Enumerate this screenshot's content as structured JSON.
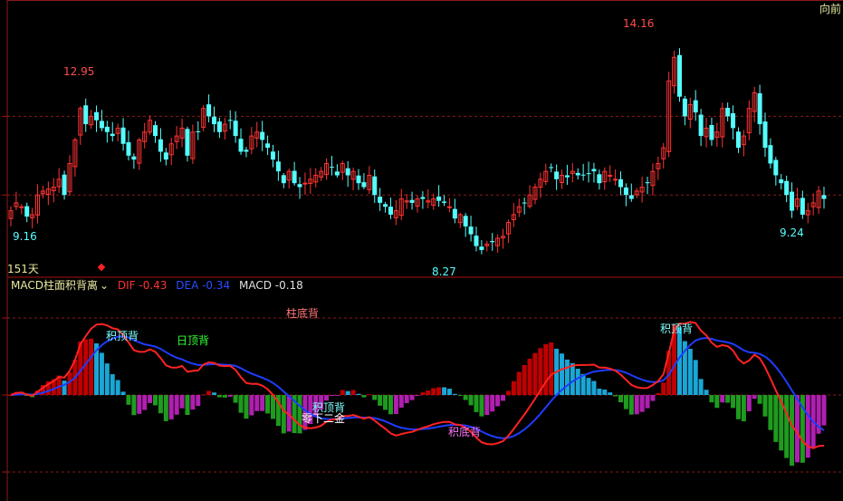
{
  "header": {
    "corner_label": "向前"
  },
  "price_panel": {
    "period_label": "151天",
    "high_label": "12.95",
    "peak_label": "14.16",
    "low_label_left": "9.16",
    "low_label_mid": "8.27",
    "low_label_right": "9.24"
  },
  "macd_panel": {
    "indicator_name": "MACD柱面积背离",
    "dif_text": "DIF -0.43",
    "dea_text": "DEA -0.34",
    "macd_text": "MACD -0.18",
    "annotations": [
      "柱底背",
      "积顶背",
      "日顶背",
      "积顶背",
      "零下二金",
      "积底背",
      "积顶背"
    ]
  },
  "colors": {
    "background": "#000000",
    "up": "#ff3333",
    "down": "#54ffff",
    "dif": "#ff2222",
    "dea": "#1f3cff",
    "hist_pos_red": "#c00000",
    "hist_pos_cyan": "#1aa6d6",
    "hist_neg_green": "#1f9b1f",
    "hist_neg_purple": "#b01fb0",
    "grid": "#8a1a1a",
    "axis": "#8a1a1a"
  },
  "chart_data": [
    {
      "type": "candlestick",
      "title": "",
      "ylim": [
        8.0,
        14.5
      ],
      "marked_values": {
        "high_left": 12.95,
        "peak": 14.16,
        "low_left": 9.16,
        "low_mid": 8.27,
        "low_right": 9.24
      },
      "close": [
        9.6,
        9.8,
        9.7,
        9.45,
        9.5,
        10.0,
        10.1,
        10.15,
        10.2,
        10.4,
        10.0,
        10.8,
        11.4,
        12.2,
        11.8,
        12.0,
        11.9,
        11.7,
        11.6,
        11.5,
        11.7,
        11.3,
        11.0,
        10.9,
        11.4,
        11.6,
        11.9,
        11.5,
        11.1,
        10.9,
        11.3,
        11.5,
        11.7,
        11.0,
        11.6,
        11.6,
        12.2,
        12.0,
        11.8,
        11.6,
        11.8,
        11.9,
        11.5,
        11.1,
        11.1,
        11.5,
        11.6,
        11.4,
        11.2,
        10.9,
        10.6,
        10.3,
        10.6,
        10.3,
        10.2,
        10.3,
        10.4,
        10.5,
        10.6,
        10.8,
        10.7,
        10.5,
        10.8,
        10.5,
        10.6,
        10.3,
        10.2,
        10.5,
        10.0,
        9.8,
        9.7,
        9.5,
        9.6,
        9.9,
        9.85,
        9.8,
        9.9,
        9.9,
        9.85,
        9.9,
        9.85,
        9.8,
        9.7,
        9.4,
        9.5,
        9.2,
        9.0,
        8.7,
        8.6,
        8.75,
        8.8,
        8.9,
        8.95,
        9.3,
        9.5,
        9.7,
        9.8,
        10.0,
        10.2,
        10.4,
        10.6,
        10.7,
        10.4,
        10.5,
        10.45,
        10.6,
        10.5,
        10.5,
        10.55,
        10.6,
        10.3,
        10.6,
        10.5,
        10.4,
        10.2,
        10.0,
        9.9,
        10.1,
        10.2,
        10.3,
        10.6,
        10.8,
        11.2,
        12.9,
        13.5,
        12.5,
        12.0,
        12.3,
        12.1,
        11.5,
        11.7,
        11.4,
        11.6,
        12.2,
        12.0,
        11.7,
        11.2,
        11.5,
        12.2,
        12.6,
        11.8,
        11.2,
        10.8,
        10.5,
        10.3,
        10.0,
        9.6,
        9.9,
        9.5,
        9.6,
        9.8,
        10.1,
        9.9
      ]
    },
    {
      "type": "macd",
      "title": "",
      "ylim": [
        -1.3,
        1.2
      ],
      "values": {
        "DIF": -0.43,
        "DEA": -0.34,
        "MACD": -0.18
      }
    }
  ]
}
